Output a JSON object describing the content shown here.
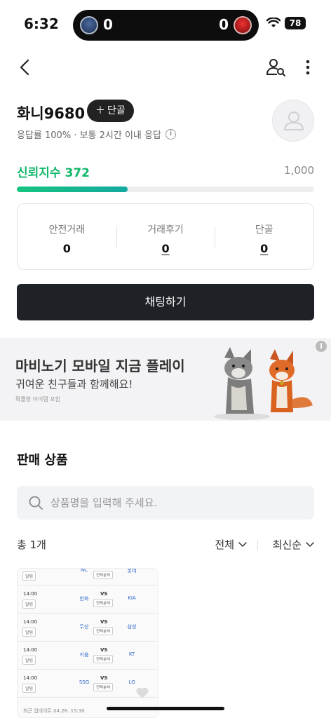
{
  "status": {
    "time": "6:32",
    "score_left": "0",
    "score_right": "0",
    "battery": "78"
  },
  "profile": {
    "nickname": "화니9680",
    "regular_button": "단골",
    "response_info": "응답률 100% · 보통 2시간 이내 응답"
  },
  "trust": {
    "label": "신뢰지수",
    "value": "372",
    "max": "1,000",
    "fraction": 0.372
  },
  "stats": [
    {
      "label": "안전거래",
      "value": "0"
    },
    {
      "label": "거래후기",
      "value": "0"
    },
    {
      "label": "단골",
      "value": "0"
    }
  ],
  "chat_button": "채팅하기",
  "ad": {
    "title": "마비노기 모바일 지금 플레이",
    "subtitle": "귀여운 친구들과 함께해요!",
    "note": "확률형 아이템 포함"
  },
  "section_title": "판매 상품",
  "search": {
    "placeholder": "상품명을 입력해 주세요."
  },
  "list": {
    "total": "총 1개",
    "filter": "전체",
    "sort": "최신순"
  },
  "product": {
    "games": [
      {
        "time": "",
        "home": "NC",
        "away": "롯데"
      },
      {
        "time": "14:00",
        "home": "한화",
        "away": "KIA"
      },
      {
        "time": "14:00",
        "home": "두산",
        "away": "삼성"
      },
      {
        "time": "14:00",
        "home": "키움",
        "away": "KT"
      },
      {
        "time": "14:00",
        "home": "SSG",
        "away": "LG"
      }
    ],
    "alarm": "알림",
    "vs": "VS",
    "analysis": "전력분석",
    "update": "최근 업데이트 04.28. 15:30"
  },
  "colors": {
    "trust_green": "#12b76a",
    "chat_bg": "#1e2226"
  }
}
